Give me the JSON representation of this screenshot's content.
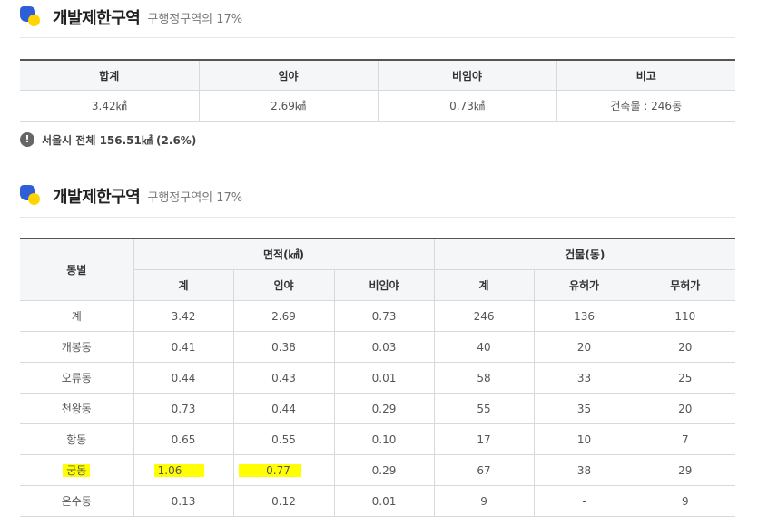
{
  "section1": {
    "title": "개발제한구역",
    "subtitle": "구행정구역의 17%"
  },
  "summary_table": {
    "headers": [
      "합계",
      "임야",
      "비임야",
      "비고"
    ],
    "row": [
      "3.42㎢",
      "2.69㎢",
      "0.73㎢",
      "건축물 : 246동"
    ]
  },
  "note": {
    "icon": "exclamation-icon",
    "prefix": "서울시 전체 ",
    "value": "156.51㎢",
    "suffix": " (2.6%)"
  },
  "section2": {
    "title": "개발제한구역",
    "subtitle": "구행정구역의 17%"
  },
  "detail_table": {
    "row_header": "동별",
    "group_area": "면적(㎢)",
    "group_building": "건물(동)",
    "sub_headers": [
      "계",
      "임야",
      "비임야",
      "계",
      "유허가",
      "무허가"
    ],
    "rows": [
      [
        "계",
        "3.42",
        "2.69",
        "0.73",
        "246",
        "136",
        "110"
      ],
      [
        "개봉동",
        "0.41",
        "0.38",
        "0.03",
        "40",
        "20",
        "20"
      ],
      [
        "오류동",
        "0.44",
        "0.43",
        "0.01",
        "58",
        "33",
        "25"
      ],
      [
        "천왕동",
        "0.73",
        "0.44",
        "0.29",
        "55",
        "35",
        "20"
      ],
      [
        "항동",
        "0.65",
        "0.55",
        "0.10",
        "17",
        "10",
        "7"
      ],
      [
        "궁동",
        "1.06",
        "0.77",
        "0.29",
        "67",
        "38",
        "29"
      ],
      [
        "온수동",
        "0.13",
        "0.12",
        "0.01",
        "9",
        "-",
        "9"
      ]
    ],
    "highlight_color": "#ffff00"
  }
}
